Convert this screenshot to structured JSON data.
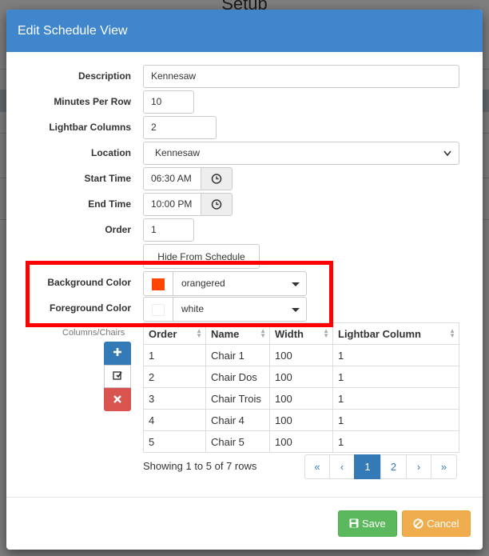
{
  "background": {
    "page_title": "Setup"
  },
  "modal": {
    "title": "Edit Schedule View",
    "accent": "#3f86cd"
  },
  "form": {
    "description": {
      "label": "Description",
      "value": "Kennesaw"
    },
    "minutes_per_row": {
      "label": "Minutes Per Row",
      "value": "10"
    },
    "lightbar_columns": {
      "label": "Lightbar Columns",
      "value": "2"
    },
    "location": {
      "label": "Location",
      "value": "Kennesaw"
    },
    "start_time": {
      "label": "Start Time",
      "value": "06:30 AM",
      "icon": "clock-icon"
    },
    "end_time": {
      "label": "End Time",
      "value": "10:00 PM",
      "icon": "clock-icon"
    },
    "order": {
      "label": "Order",
      "value": "1"
    },
    "hide_button": {
      "label": "Hide From Schedule"
    },
    "background_color": {
      "label": "Background Color",
      "value": "orangered",
      "swatch": "#ff4500"
    },
    "foreground_color": {
      "label": "Foreground Color",
      "value": "white",
      "swatch": "#ffffff"
    }
  },
  "columns_section": {
    "label": "Columns/Chairs",
    "toolbar": {
      "add_icon": "plus-icon",
      "edit_icon": "edit-icon",
      "delete_icon": "delete-icon"
    }
  },
  "table": {
    "headers": [
      "Order",
      "Name",
      "Width",
      "Lightbar Column"
    ],
    "rows": [
      [
        "1",
        "Chair 1",
        "100",
        "1"
      ],
      [
        "2",
        "Chair Dos",
        "100",
        "1"
      ],
      [
        "3",
        "Chair Trois",
        "100",
        "1"
      ],
      [
        "4",
        "Chair 4",
        "100",
        "1"
      ],
      [
        "5",
        "Chair 5",
        "100",
        "1"
      ]
    ]
  },
  "pagination": {
    "summary": "Showing 1 to 5 of 7 rows",
    "first": "«",
    "prev": "‹",
    "pages": [
      "1",
      "2"
    ],
    "current_page": "1",
    "next": "›",
    "last": "»"
  },
  "footer": {
    "save_label": "Save",
    "cancel_label": "Cancel",
    "save_color": "#5cb85c",
    "cancel_color": "#f0ad4e"
  }
}
